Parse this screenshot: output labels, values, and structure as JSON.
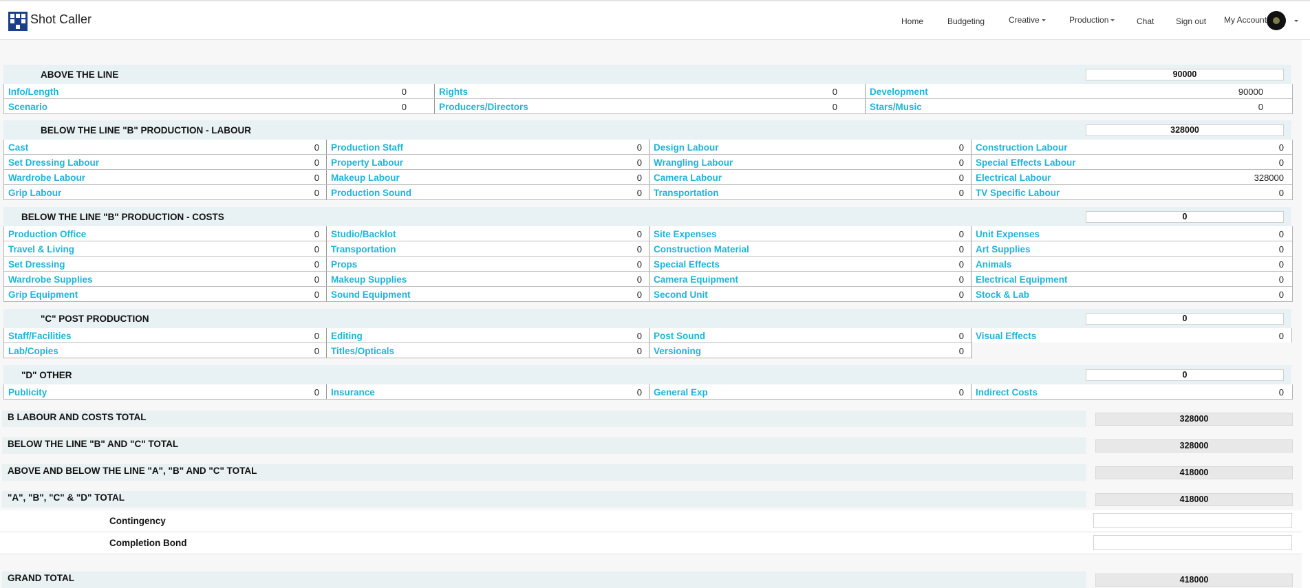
{
  "app": {
    "title": "Shot Caller"
  },
  "nav": {
    "home": "Home",
    "budgeting": "Budgeting",
    "creative": "Creative",
    "production": "Production",
    "chat": "Chat",
    "signout": "Sign out",
    "account": "My Account"
  },
  "sections": {
    "atl": {
      "title": "ABOVE THE LINE",
      "total": "90000",
      "rows": [
        [
          {
            "label": "Info/Length",
            "value": "0"
          },
          {
            "label": "Rights",
            "value": "0"
          },
          {
            "label": "Development",
            "value": "90000"
          }
        ],
        [
          {
            "label": "Scenario",
            "value": "0"
          },
          {
            "label": "Producers/Directors",
            "value": "0"
          },
          {
            "label": "Stars/Music",
            "value": "0"
          }
        ]
      ]
    },
    "labour": {
      "title": "BELOW THE LINE \"B\" PRODUCTION - LABOUR",
      "total": "328000",
      "rows": [
        [
          {
            "label": "Cast",
            "value": "0"
          },
          {
            "label": "Production Staff",
            "value": "0"
          },
          {
            "label": "Design Labour",
            "value": "0"
          },
          {
            "label": "Construction Labour",
            "value": "0"
          }
        ],
        [
          {
            "label": "Set Dressing Labour",
            "value": "0"
          },
          {
            "label": "Property Labour",
            "value": "0"
          },
          {
            "label": "Wrangling Labour",
            "value": "0"
          },
          {
            "label": "Special Effects Labour",
            "value": "0"
          }
        ],
        [
          {
            "label": "Wardrobe Labour",
            "value": "0"
          },
          {
            "label": "Makeup Labour",
            "value": "0"
          },
          {
            "label": "Camera Labour",
            "value": "0"
          },
          {
            "label": "Electrical Labour",
            "value": "328000"
          }
        ],
        [
          {
            "label": "Grip Labour",
            "value": "0"
          },
          {
            "label": "Production Sound",
            "value": "0"
          },
          {
            "label": "Transportation",
            "value": "0"
          },
          {
            "label": "TV Specific Labour",
            "value": "0"
          }
        ]
      ]
    },
    "costs": {
      "title": "BELOW THE LINE \"B\" PRODUCTION - COSTS",
      "total": "0",
      "rows": [
        [
          {
            "label": "Production Office",
            "value": "0"
          },
          {
            "label": "Studio/Backlot",
            "value": "0"
          },
          {
            "label": "Site Expenses",
            "value": "0"
          },
          {
            "label": "Unit Expenses",
            "value": "0"
          }
        ],
        [
          {
            "label": "Travel & Living",
            "value": "0"
          },
          {
            "label": "Transportation",
            "value": "0"
          },
          {
            "label": "Construction Material",
            "value": "0"
          },
          {
            "label": "Art Supplies",
            "value": "0"
          }
        ],
        [
          {
            "label": "Set Dressing",
            "value": "0"
          },
          {
            "label": "Props",
            "value": "0"
          },
          {
            "label": "Special Effects",
            "value": "0"
          },
          {
            "label": "Animals",
            "value": "0"
          }
        ],
        [
          {
            "label": "Wardrobe Supplies",
            "value": "0"
          },
          {
            "label": "Makeup Supplies",
            "value": "0"
          },
          {
            "label": "Camera Equipment",
            "value": "0"
          },
          {
            "label": "Electrical Equipment",
            "value": "0"
          }
        ],
        [
          {
            "label": "Grip Equipment",
            "value": "0"
          },
          {
            "label": "Sound Equipment",
            "value": "0"
          },
          {
            "label": "Second Unit",
            "value": "0"
          },
          {
            "label": "Stock & Lab",
            "value": "0"
          }
        ]
      ]
    },
    "post": {
      "title": "\"C\" POST PRODUCTION",
      "total": "0",
      "rows": [
        [
          {
            "label": "Staff/Facilities",
            "value": "0"
          },
          {
            "label": "Editing",
            "value": "0"
          },
          {
            "label": "Post Sound",
            "value": "0"
          },
          {
            "label": "Visual Effects",
            "value": "0"
          }
        ],
        [
          {
            "label": "Lab/Copies",
            "value": "0"
          },
          {
            "label": "Titles/Opticals",
            "value": "0"
          },
          {
            "label": "Versioning",
            "value": "0"
          },
          null
        ]
      ]
    },
    "other": {
      "title": "\"D\" OTHER",
      "total": "0",
      "rows": [
        [
          {
            "label": "Publicity",
            "value": "0"
          },
          {
            "label": "Insurance",
            "value": "0"
          },
          {
            "label": "General Exp",
            "value": "0"
          },
          {
            "label": "Indirect Costs",
            "value": "0"
          }
        ]
      ]
    }
  },
  "totals": [
    {
      "label": "B LABOUR AND COSTS TOTAL",
      "value": "328000"
    },
    {
      "label": "BELOW THE LINE \"B\" AND \"C\" TOTAL",
      "value": "328000"
    },
    {
      "label": "ABOVE AND BELOW THE LINE \"A\", \"B\" AND \"C\" TOTAL",
      "value": "418000"
    },
    {
      "label": "\"A\", \"B\", \"C\" & \"D\" TOTAL",
      "value": "418000"
    }
  ],
  "contingency": {
    "label": "Contingency",
    "value": ""
  },
  "completion_bond": {
    "label": "Completion Bond",
    "value": ""
  },
  "grand_total": {
    "label": "GRAND TOTAL",
    "value": "418000"
  }
}
